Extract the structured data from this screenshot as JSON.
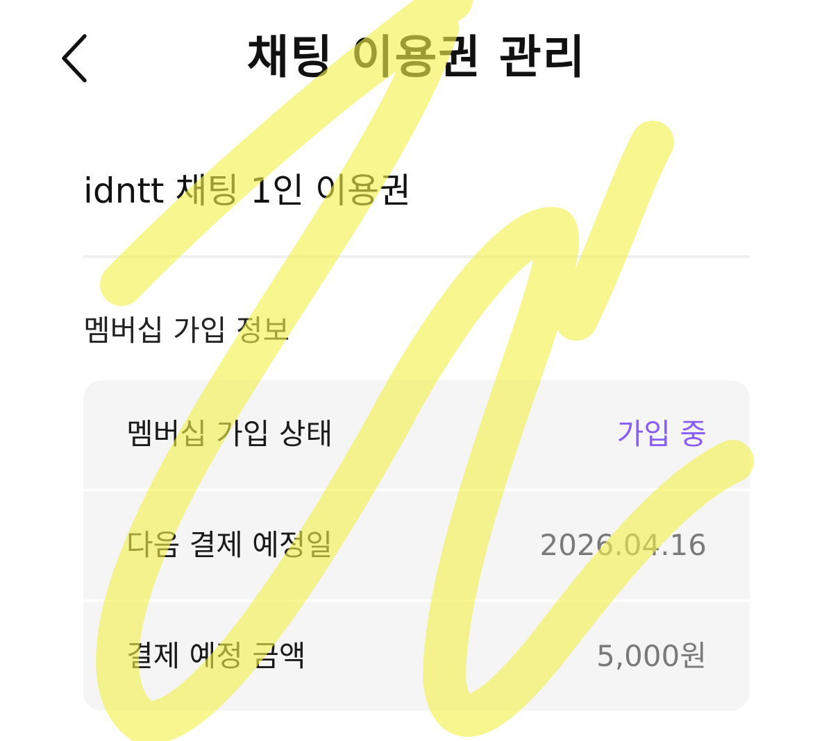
{
  "header": {
    "back_icon": "chevron-left-icon",
    "title": "채팅 이용권 관리"
  },
  "product": {
    "name": "idntt 채팅 1인 이용권"
  },
  "membership": {
    "section_title": "멤버십 가입 정보",
    "rows": [
      {
        "label": "멤버십 가입 상태",
        "value": "가입 중"
      },
      {
        "label": "다음 결제 예정일",
        "value": "2026.04.16"
      },
      {
        "label": "결제 예정 금액",
        "value": "5,000원"
      }
    ]
  },
  "colors": {
    "accent": "#8a5cf6",
    "highlighter": "#f2f04a"
  }
}
